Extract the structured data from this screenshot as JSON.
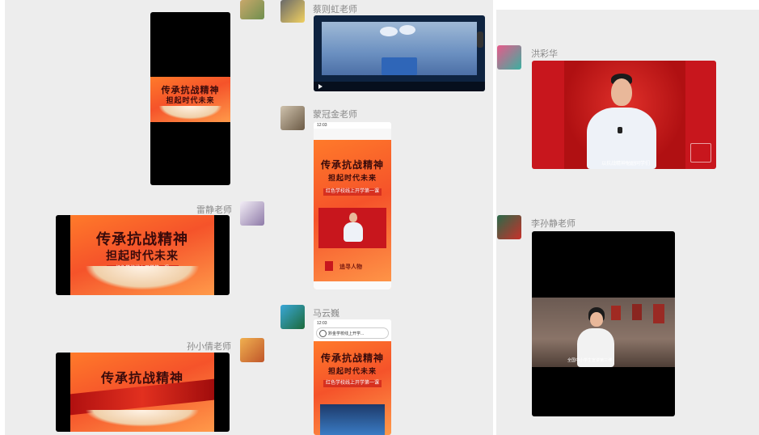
{
  "chat_left": {
    "messages": [
      {
        "sender": "蔡则虹老师"
      },
      {
        "sender": "蒙冠金老师"
      },
      {
        "sender": "雷静老师"
      },
      {
        "sender": "马云巍"
      },
      {
        "sender": "孙小倩老师"
      }
    ],
    "poster": {
      "title_line1": "传承抗战精神",
      "title_line2": "担起时代未来",
      "subtitle": "红色学校线上开学第一课",
      "banner": "追寻人物"
    },
    "phone": {
      "search_text": "黔金学校线上开学...",
      "status_time": "12:03"
    }
  },
  "chat_right": {
    "messages": [
      {
        "sender": "洪彩华",
        "caption": "以抗战精神勉励同学们"
      },
      {
        "sender": "李孙静老师",
        "caption": "全国中小学生宣讲第三课"
      }
    ]
  },
  "colors": {
    "panel_bg": "#ededed",
    "poster_orange": "#f5532a",
    "stage_red": "#c8161d"
  }
}
